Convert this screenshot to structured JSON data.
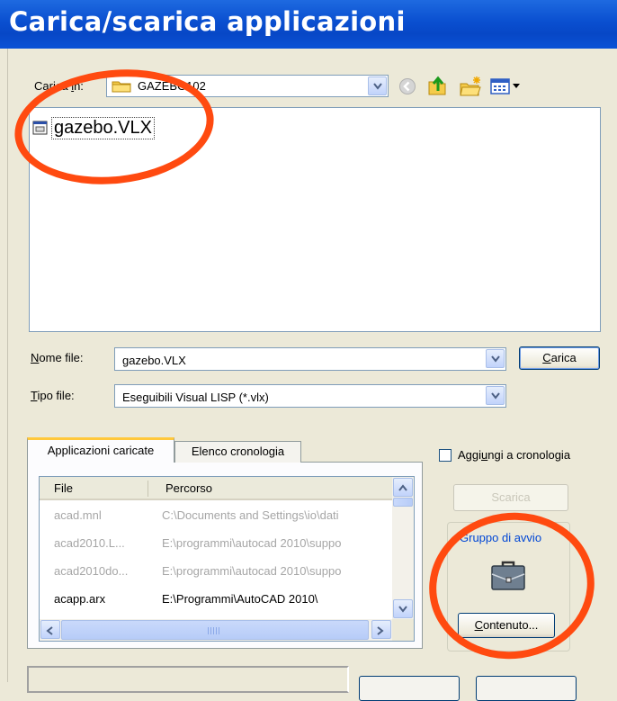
{
  "window": {
    "title": "Carica/scarica applicazioni"
  },
  "look_in": {
    "label_pre": "Ca",
    "label_post": "rica ",
    "label_key": "i",
    "label_end": "n:",
    "value": "GAZEBO102",
    "folder_icon": "folder-icon"
  },
  "toolbar": {
    "back_icon": "back-icon",
    "up_icon": "up-one-level-icon",
    "new_folder_icon": "new-folder-icon",
    "views_icon": "views-menu-icon"
  },
  "file_list": {
    "items": [
      {
        "name": "gazebo.VLX",
        "icon": "vlx-file-icon"
      }
    ]
  },
  "file_name": {
    "label_key": "N",
    "label_rest": "ome file:",
    "value": "gazebo.VLX",
    "load_key": "C",
    "load_rest": "arica"
  },
  "file_type": {
    "label_key": "T",
    "label_rest": "ipo file:",
    "value": "Eseguibili Visual LISP (*.vlx)"
  },
  "tabs": [
    {
      "label": "Applicazioni caricate",
      "active": true
    },
    {
      "label": "Elenco cronologia",
      "active": false
    }
  ],
  "loaded_apps": {
    "columns": [
      "File",
      "Percorso"
    ],
    "rows": [
      {
        "file": "acad.mnl",
        "path": "C:\\Documents and Settings\\io\\dati",
        "dim": true
      },
      {
        "file": "acad2010.L...",
        "path": "E:\\programmi\\autocad 2010\\suppo",
        "dim": true
      },
      {
        "file": "acad2010do...",
        "path": "E:\\programmi\\autocad 2010\\suppo",
        "dim": true
      },
      {
        "file": "acapp.arx",
        "path": "E:\\Programmi\\AutoCAD 2010\\",
        "dim": false
      }
    ]
  },
  "history": {
    "checked": false,
    "label_pre": "Aggi",
    "label_key": "u",
    "label_post": "ngi a cronologia"
  },
  "unload_button": "Scarica",
  "startup_suite": {
    "title": "Gruppo di avvio",
    "icon": "briefcase-icon",
    "button_key": "C",
    "button_rest": "ontenuto..."
  },
  "colors": {
    "titlebar": "#0a4fd0",
    "annotation": "#ff4a10",
    "link_blue": "#0046d5"
  }
}
